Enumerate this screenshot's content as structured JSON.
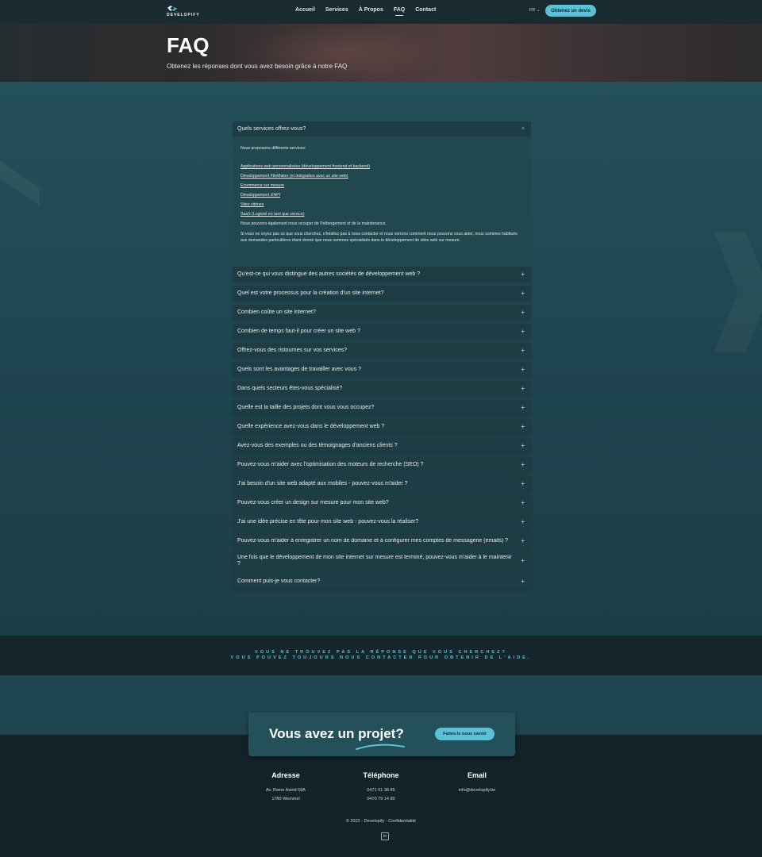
{
  "header": {
    "logo_text": "DEVELOPIFY",
    "nav": [
      {
        "label": "Accueil",
        "active": false
      },
      {
        "label": "Services",
        "active": false
      },
      {
        "label": "À Propos",
        "active": false
      },
      {
        "label": "FAQ",
        "active": true
      },
      {
        "label": "Contact",
        "active": false
      }
    ],
    "lang": "FR",
    "lang_icon": "chevron-down-icon",
    "cta_label": "Obtenez un devis"
  },
  "hero": {
    "title": "FAQ",
    "subtitle": "Obtenez les réponses dont vous avez besoin grâce à notre FAQ"
  },
  "faq": {
    "open_item": {
      "question": "Quels services offrez-vous?",
      "close_icon": "×",
      "intro": "Nous proposons différents services:",
      "links": [
        "Applications web personnalisées (développement frontend et backend)",
        "Développement FileMaker (et intégration avec un site web)",
        "Ecommerce sur mesure",
        "Développement d'API",
        "Sites vitrines",
        "SaaS (Logiciel en tant que service)"
      ],
      "para1": "Nous pouvons également nous occuper de l'hébergement et de la maintenance.",
      "para2": "Si vous ne voyez pas ce que vous cherchez, n'hésitez pas à nous contacter et nous verrons comment nous pouvons vous aider, nous sommes habitués aux demandes particulières étant donné que nous sommes spécialisés dans le développement de sites web sur mesure."
    },
    "plus_icon": "+",
    "items": [
      "Qu'est-ce qui vous distingue des autres sociétés de développement web ?",
      "Quel est votre processus pour la création d'un site internet?",
      "Combien coûte un site internet?",
      "Combien de temps faut-il pour créer un site web ?",
      "Offrez-vous des ristournes sur vos services?",
      "Quels sont les avantages de travailler avec vous ?",
      "Dans quels secteurs êtes-vous spécialisé?",
      "Quelle est la taille des projets dont vous vous occupez?",
      "Quelle expérience avez-vous dans le développement web ?",
      "Avez-vous des exemples ou des témoignages d'anciens clients ?",
      "Pouvez-vous m'aider avec l'optimisation des moteurs de recherche (SEO) ?",
      "J'ai besoin d'un site web adapté aux mobiles - pouvez-vous m'aider ?",
      "Pouvez-vous créer un design sur mesure pour mon site web?",
      "J'ai une idée précise en tête pour mon site web - pouvez-vous la réaliser?",
      "Pouvez-vous m'aider à enregistrer un nom de domaine et à configurer mes comptes de messagerie (emails) ?",
      "Une fois que le développement de mon site internet sur mesure est terminé, pouvez-vous m'aider à le maintenir ?",
      "Comment puis-je vous contacter?"
    ]
  },
  "help_band": {
    "line1": "VOUS NE TROUVEZ PAS LA RÉPONSE QUE VOUS CHERCHEZ?",
    "line2": "VOUS POUVEZ TOUJOURS NOUS CONTACTER POUR OBTENIR DE L'AIDE."
  },
  "project": {
    "title": "Vous avez un projet?",
    "button": "Faites-le nous savoir"
  },
  "footer": {
    "address": {
      "title": "Adresse",
      "line1": "Av. Reine Astrid 59A",
      "line2": "1780 Wemmel"
    },
    "phone": {
      "title": "Téléphone",
      "line1": "0471 01 38 85",
      "line2": "0470 79 14 80"
    },
    "email": {
      "title": "Email",
      "line1": "info@developify.be"
    },
    "copyright": "© 2022 - Developify - Confidentialité",
    "linkedin_icon": "in"
  },
  "colors": {
    "accent": "#5cc1d6",
    "page_bg": "#1f4550",
    "footer_bg": "#14232a"
  }
}
